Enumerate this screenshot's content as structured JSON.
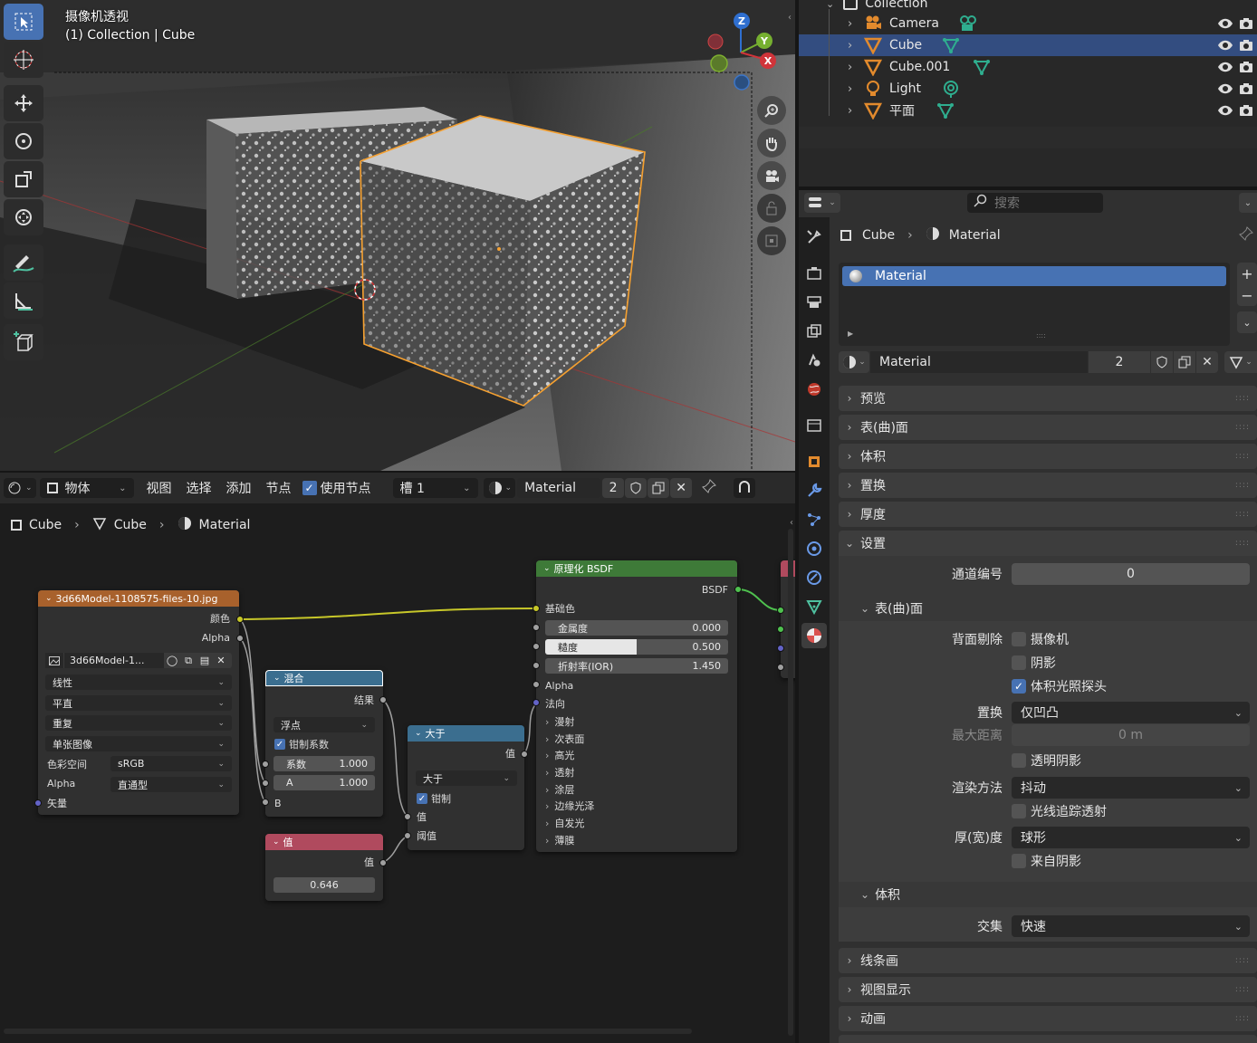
{
  "viewport": {
    "title": "摄像机透视",
    "subtitle": "(1) Collection | Cube",
    "gizmo": {
      "z": "Z",
      "y": "Y",
      "x": "X"
    },
    "tools": [
      "select-box-icon",
      "cursor-icon",
      "move-icon",
      "rotate-icon",
      "scale-icon",
      "transform-icon",
      "annotate-icon",
      "measure-icon",
      "add-cube-icon"
    ],
    "nav": [
      "zoom-icon",
      "hand-icon",
      "camera-icon",
      "lock-icon",
      "frame-icon"
    ],
    "colors": {
      "selection": "#f5a030",
      "background": "#3a3a3a"
    }
  },
  "node_editor": {
    "header": {
      "mode": "物体",
      "menus": [
        "视图",
        "选择",
        "添加",
        "节点"
      ],
      "use_nodes": "使用节点",
      "slot": "槽 1",
      "material": "Material",
      "users": "2"
    },
    "breadcrumb": [
      "Cube",
      "Cube",
      "Material"
    ],
    "nodes": {
      "image": {
        "title": "3d66Model-1108575-files-10.jpg",
        "out_color": "颜色",
        "out_alpha": "Alpha",
        "image_name": "3d66Model-1...",
        "interpolation": "线性",
        "projection": "平直",
        "extension": "重复",
        "source": "单张图像",
        "colorspace_label": "色彩空间",
        "colorspace": "sRGB",
        "alpha_label": "Alpha",
        "alpha": "直通型",
        "in_vector": "矢量"
      },
      "mix": {
        "title": "混合",
        "out_result": "结果",
        "type": "浮点",
        "clamp": "钳制系数",
        "factor_label": "系数",
        "factor": "1.000",
        "a_label": "A",
        "a": "1.000",
        "b_label": "B"
      },
      "greater": {
        "title": "大于",
        "out_value": "值",
        "op": "大于",
        "clamp": "钳制",
        "in_value": "值",
        "in_threshold": "阈值"
      },
      "value": {
        "title": "值",
        "out_value": "值",
        "value": "0.646"
      },
      "bsdf": {
        "title": "原理化 BSDF",
        "out": "BSDF",
        "base_color": "基础色",
        "metallic_label": "金属度",
        "metallic": "0.000",
        "roughness_label": "糙度",
        "roughness": "0.500",
        "roughness_fill": 0.5,
        "ior_label": "折射率(IOR)",
        "ior": "1.450",
        "alpha": "Alpha",
        "normal": "法向",
        "sections": [
          "漫射",
          "次表面",
          "高光",
          "透射",
          "涂层",
          "边缘光泽",
          "自发光",
          "薄膜"
        ]
      }
    },
    "colors": {
      "image_head": "#a8612c",
      "mix_head": "#3b6e8f",
      "greater_head": "#3b6e8f",
      "value_head": "#b04a5e",
      "bsdf_head": "#3e7a38",
      "wire_yellow": "#c7c729",
      "wire_gray": "#a0a0a0",
      "wire_green": "#4fc14f"
    }
  },
  "outliner": {
    "collection": "Collection",
    "items": [
      {
        "name": "Camera",
        "icon": "camera-object-icon",
        "data_icon": "camera-data-icon",
        "selected": false
      },
      {
        "name": "Cube",
        "icon": "mesh-object-icon",
        "data_icon": "mesh-data-icon",
        "selected": true
      },
      {
        "name": "Cube.001",
        "icon": "mesh-object-icon",
        "data_icon": "mesh-data-icon",
        "selected": false
      },
      {
        "name": "Light",
        "icon": "light-object-icon",
        "data_icon": "light-data-icon",
        "selected": false
      },
      {
        "name": "平面",
        "icon": "mesh-object-icon",
        "data_icon": "mesh-data-icon",
        "selected": false
      }
    ]
  },
  "properties": {
    "search_placeholder": "搜索",
    "breadcrumb": {
      "object": "Cube",
      "material": "Material"
    },
    "slot_item": "Material",
    "material_name": "Material",
    "material_users": "2",
    "panels": {
      "preview": "预览",
      "surface": "表(曲)面",
      "volume": "体积",
      "displacement": "置换",
      "thickness": "厚度",
      "settings": "设置",
      "lineart": "线条画",
      "viewport_display": "视图显示",
      "animation": "动画"
    },
    "settings": {
      "pass_index_label": "通道编号",
      "pass_index": "0",
      "surface_sub": "表(曲)面",
      "backface_label": "背面剔除",
      "backface_camera": "摄像机",
      "backface_shadow": "阴影",
      "backface_probe": "体积光照探头",
      "displacement_label": "置换",
      "displacement": "仅凹凸",
      "max_distance_label": "最大距离",
      "max_distance": "0 m",
      "transparent_shadow": "透明阴影",
      "render_method_label": "渲染方法",
      "render_method": "抖动",
      "raytrace_transmission": "光线追踪透射",
      "thickness_label": "厚(宽)度",
      "thickness": "球形",
      "from_shadow": "来自阴影",
      "volume_sub": "体积",
      "intersection_label": "交集",
      "intersection": "快速"
    }
  }
}
